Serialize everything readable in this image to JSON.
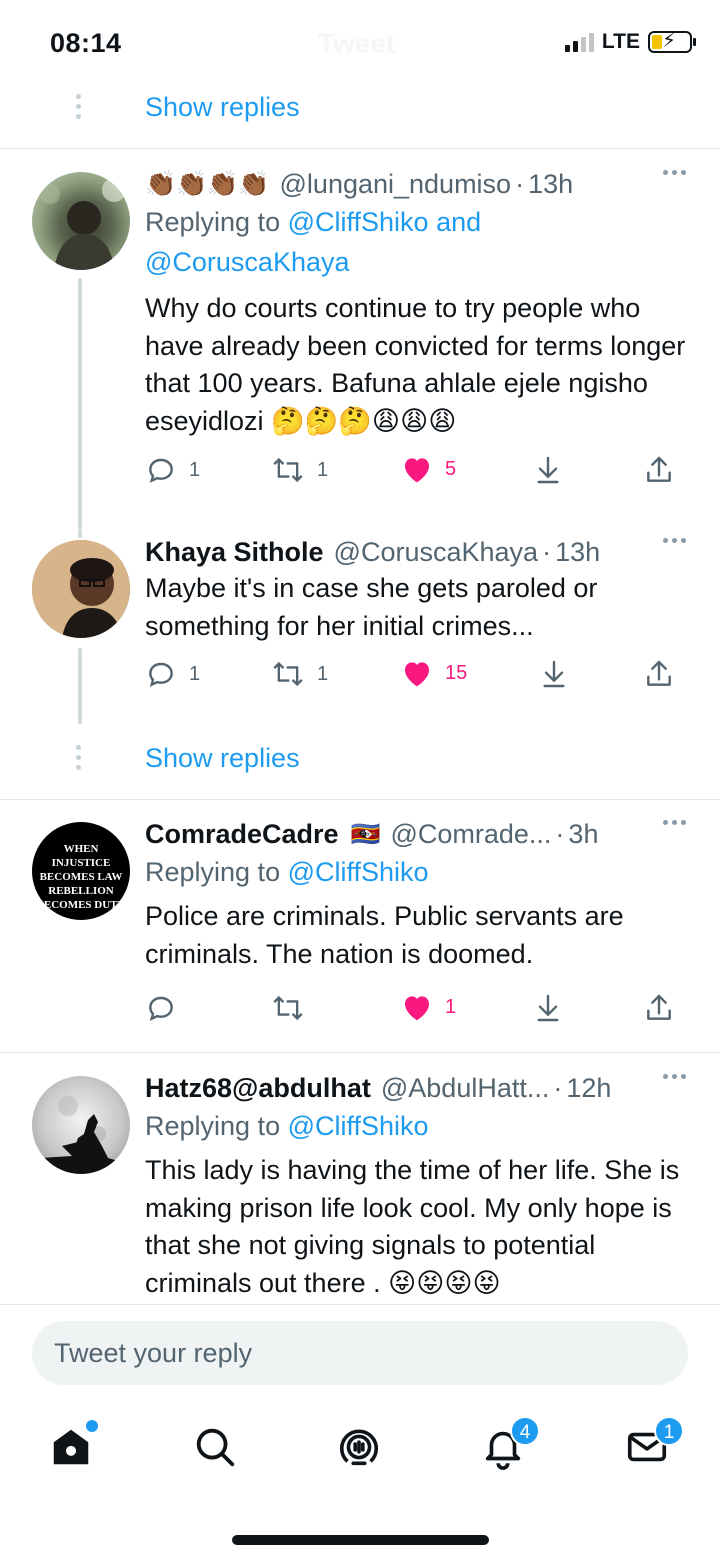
{
  "status_bar": {
    "time": "08:14",
    "network": "LTE",
    "faded_title": "Tweet"
  },
  "show_replies_label": "Show replies",
  "tweets": [
    {
      "prefix_emoji": "👏🏾👏🏾👏🏾👏🏾",
      "display_name": "",
      "handle": "@lungani_ndumiso",
      "time": "13h",
      "replying_prefix": "Replying to",
      "replying_to": "@CliffShiko and @CoruscaKhaya",
      "text": "Why do courts continue to try people who have already been convicted for terms longer that 100 years. Bafuna ahlale ejele ngisho eseyidlozi 🤔🤔🤔😩😩😩",
      "replies": "1",
      "retweets": "1",
      "likes": "5"
    },
    {
      "display_name": "Khaya Sithole",
      "handle": "@CoruscaKhaya",
      "time": "13h",
      "text": "Maybe it's in case she gets paroled or something for her initial crimes...",
      "replies": "1",
      "retweets": "1",
      "likes": "15"
    },
    {
      "display_name": "ComradeCadre",
      "flag_emoji": "🇸🇿",
      "handle": "@Comrade...",
      "time": "3h",
      "replying_prefix": "Replying to",
      "replying_to": "@CliffShiko",
      "avatar_text": "WHEN INJUSTICE BECOMES LAW REBELLION BECOMES DUTY",
      "text": "Police are criminals. Public servants are criminals.  The nation is doomed.",
      "replies": "",
      "retweets": "",
      "likes": "1"
    },
    {
      "display_name": "Hatz68@abdulhat",
      "handle": "@AbdulHatt...",
      "time": "12h",
      "replying_prefix": "Replying to",
      "replying_to": "@CliffShiko",
      "text": "This lady is having the time of her life. She is making prison life look cool. My only hope is that she not giving signals to potential criminals out there . 😝😝😝😝"
    }
  ],
  "reply_placeholder": "Tweet your reply",
  "tab_bar": {
    "tabs": [
      "home-icon",
      "search-icon",
      "spaces-icon",
      "notifications-icon",
      "messages-icon"
    ],
    "notifications_badge": "4",
    "messages_badge": "1"
  },
  "colors": {
    "accent": "#1d9bf0",
    "like": "#f91880",
    "secondary_text": "#536471"
  }
}
